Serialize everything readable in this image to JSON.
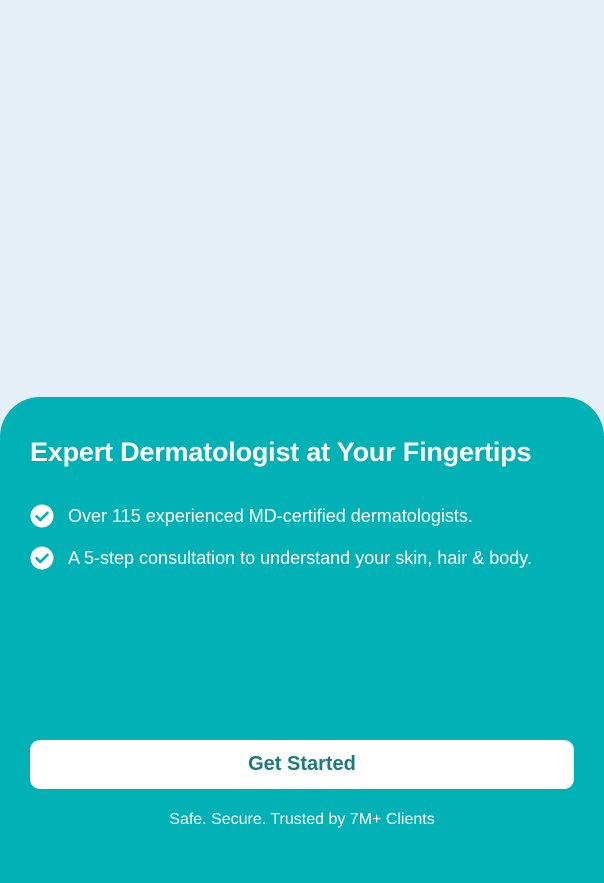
{
  "onboarding": {
    "title": "Expert Dermatologist at Your Fingertips",
    "features": [
      {
        "icon": "check-circle-icon",
        "text": "Over 115 experienced MD-certified dermatologists."
      },
      {
        "icon": "check-circle-icon",
        "text": "A 5-step consultation to understand your skin, hair & body."
      }
    ],
    "cta_label": "Get Started",
    "trust_text": "Safe. Secure. Trusted by 7M+ Clients"
  },
  "colors": {
    "background": "#e4eff7",
    "sheet": "#00b1b6",
    "button_bg": "#ffffff",
    "button_text": "#1c7a7d",
    "text": "#ffffff"
  }
}
